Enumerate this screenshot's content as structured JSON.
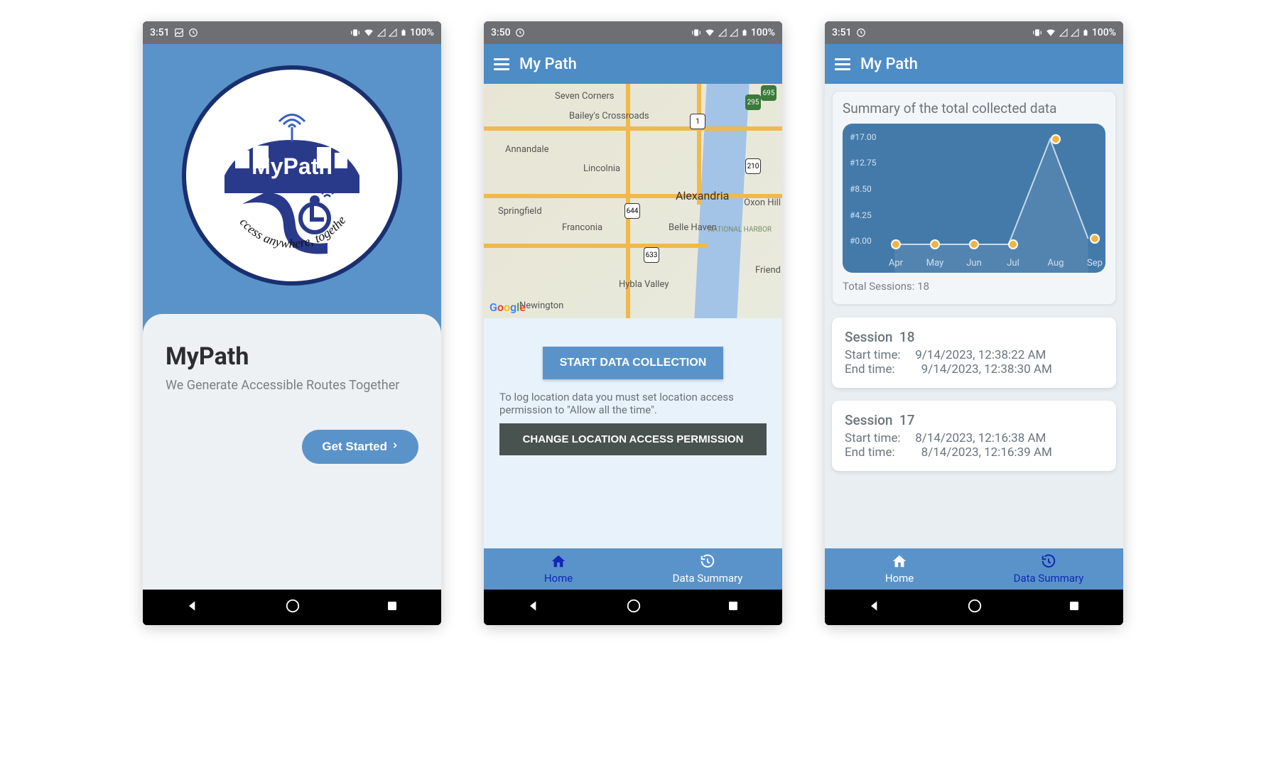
{
  "colors": {
    "primary": "#5a93c9",
    "headerBlue": "#4e8cc5",
    "darkBtn": "#48524f",
    "accentBlue": "#1029b7"
  },
  "screen1": {
    "status": {
      "time": "3:51",
      "battery": "100%"
    },
    "logo": {
      "brand": "MyPath",
      "tagline": "Access anywhere, together"
    },
    "title": "MyPath",
    "subtitle": "We Generate Accessible Routes Together",
    "cta": "Get Started"
  },
  "screen2": {
    "status": {
      "time": "3:50",
      "battery": "100%"
    },
    "header": {
      "title": "My Path"
    },
    "map": {
      "attribution": "Google",
      "places": [
        "Seven Corners",
        "Bailey's Crossroads",
        "Annandale",
        "Lincolnia",
        "Springfield",
        "Franconia",
        "Newington",
        "Hybla Valley",
        "Belle Haven",
        "Alexandria",
        "Oxon Hill",
        "NATIONAL HARBOR",
        "Friend"
      ],
      "routes": [
        "1",
        "644",
        "633",
        "210",
        "295",
        "695"
      ]
    },
    "start_btn": "START DATA COLLECTION",
    "help": "To log location data you must set location access permission to \"Allow all the time\".",
    "perm_btn": "CHANGE LOCATION ACCESS PERMISSION",
    "tabs": {
      "home": "Home",
      "summary": "Data Summary"
    }
  },
  "screen3": {
    "status": {
      "time": "3:51",
      "battery": "100%"
    },
    "header": {
      "title": "My Path"
    },
    "summary_title": "Summary of the total collected data",
    "total_sessions_label": "Total Sessions: 18",
    "sessions": [
      {
        "num": "18",
        "start": "9/14/2023, 12:38:22 AM",
        "end": "9/14/2023, 12:38:30 AM"
      },
      {
        "num": "17",
        "start": "8/14/2023, 12:16:38 AM",
        "end": "8/14/2023, 12:16:39 AM"
      }
    ],
    "tabs": {
      "home": "Home",
      "summary": "Data Summary"
    },
    "session_label": "Session",
    "start_label": "Start time:",
    "end_label": "End time:"
  },
  "chart_data": {
    "type": "line",
    "title": "Summary of the total collected data",
    "categories": [
      "Apr",
      "May",
      "Jun",
      "Jul",
      "Aug",
      "Sep"
    ],
    "values": [
      0,
      0,
      0,
      0,
      17,
      1
    ],
    "y_ticks": [
      "#0.00",
      "#4.25",
      "#8.50",
      "#12.75",
      "#17.00"
    ],
    "ylim": [
      0,
      17
    ],
    "xlabel": "",
    "ylabel": ""
  }
}
